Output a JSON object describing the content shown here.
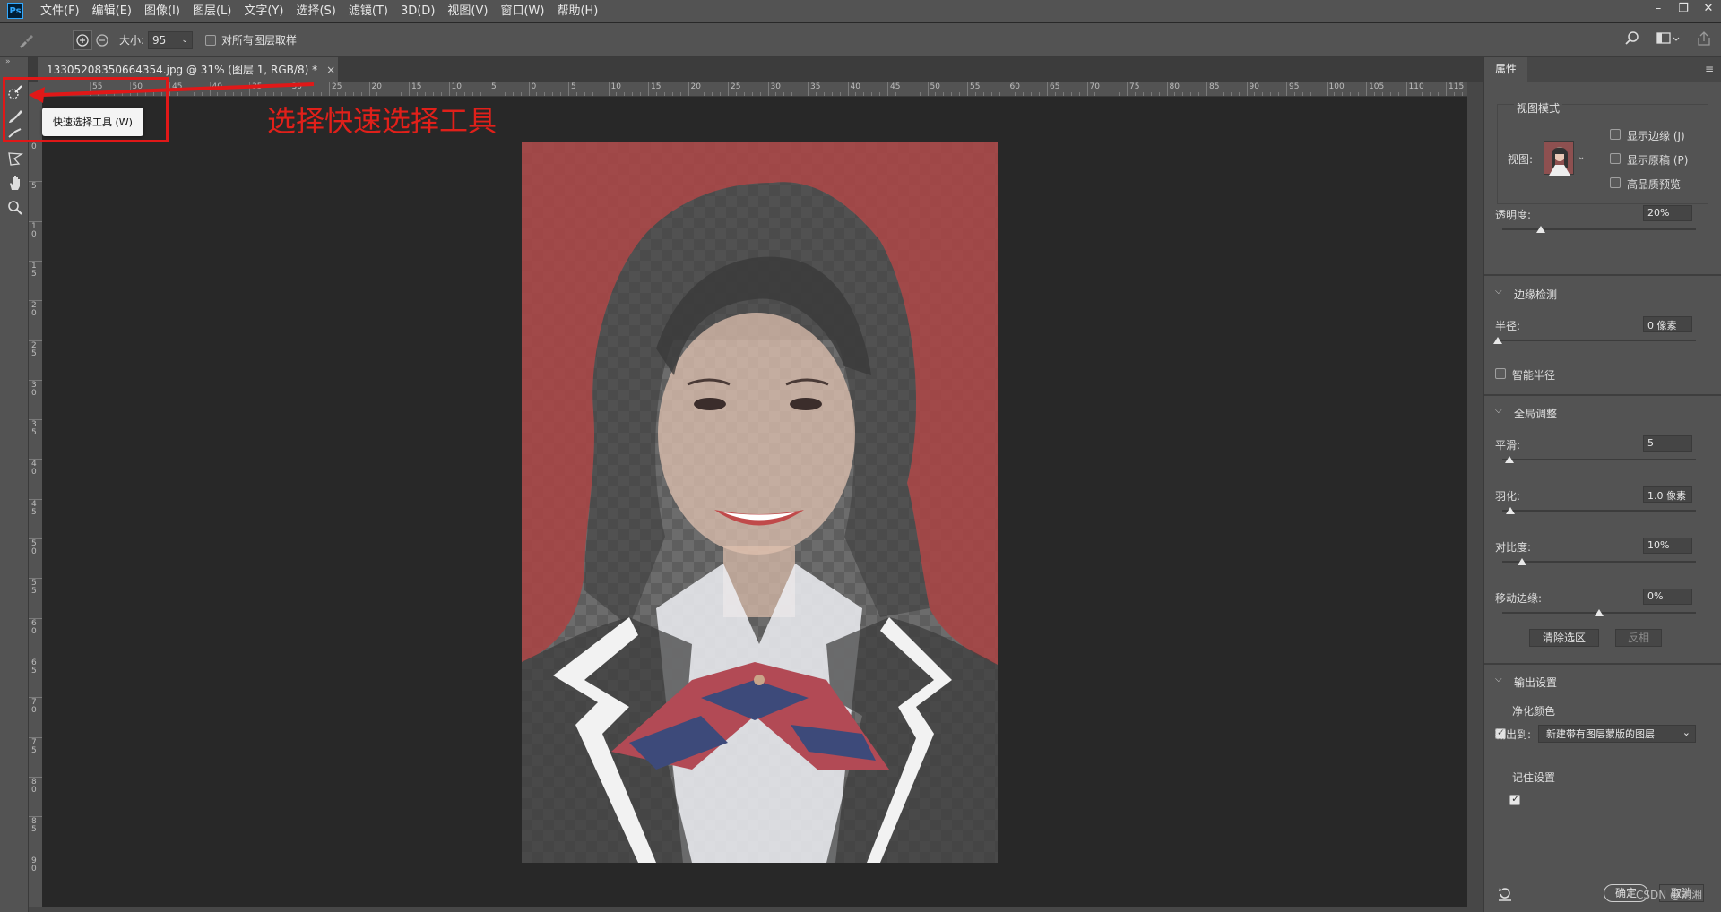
{
  "menubar": {
    "logo": "Ps",
    "items": [
      "文件(F)",
      "编辑(E)",
      "图像(I)",
      "图层(L)",
      "文字(Y)",
      "选择(S)",
      "滤镜(T)",
      "3D(D)",
      "视图(V)",
      "窗口(W)",
      "帮助(H)"
    ]
  },
  "options": {
    "size_label": "大小:",
    "size_value": "95",
    "sample_all_label": "对所有图层取样"
  },
  "document": {
    "tab_title": "13305208350664354.jpg @ 31% (图层 1, RGB/8) *",
    "close": "×"
  },
  "rulers": {
    "top_labels": [
      "55",
      "50",
      "45",
      "40",
      "35",
      "30",
      "25",
      "20",
      "15",
      "10",
      "5",
      "0",
      "5",
      "10",
      "15",
      "20",
      "25",
      "30",
      "35",
      "40",
      "45",
      "50",
      "55",
      "60",
      "65",
      "70",
      "75",
      "80",
      "85",
      "90",
      "95",
      "100",
      "105",
      "110",
      "115"
    ],
    "left_labels": [
      "0",
      "5",
      "10",
      "15",
      "20",
      "25",
      "30",
      "35",
      "40",
      "45",
      "50",
      "55",
      "60",
      "65",
      "70",
      "75",
      "80",
      "85",
      "90"
    ]
  },
  "annotation": {
    "tooltip": "快速选择工具 (W)",
    "caption": "选择快速选择工具"
  },
  "properties": {
    "tab": "属性",
    "view_mode": {
      "title": "视图模式",
      "view_label": "视图:",
      "show_edge": "显示边缘 (J)",
      "show_original": "显示原稿 (P)",
      "hq_preview": "高品质预览"
    },
    "transparency": {
      "label": "透明度:",
      "value": "20%",
      "level": 0.2
    },
    "edge_detection": {
      "title": "边缘检测",
      "radius_label": "半径:",
      "radius_value": "0 像素",
      "smart_radius": "智能半径"
    },
    "global": {
      "title": "全局调整",
      "smooth_label": "平滑:",
      "smooth_value": "5",
      "feather_label": "羽化:",
      "feather_value": "1.0 像素",
      "contrast_label": "对比度:",
      "contrast_value": "10%",
      "shift_label": "移动边缘:",
      "shift_value": "0%",
      "clear_btn": "清除选区",
      "invert_btn": "反相"
    },
    "output": {
      "title": "输出设置",
      "decontaminate": "净化颜色",
      "output_to_label": "输出到:",
      "output_to_value": "新建带有图层蒙版的图层",
      "remember": "记住设置"
    },
    "ok": "确定",
    "cancel": "取消"
  },
  "watermark": "CSDN @刘湘",
  "colors": {
    "overlay_red": "#a94444",
    "accent_annotation": "#e01818"
  }
}
